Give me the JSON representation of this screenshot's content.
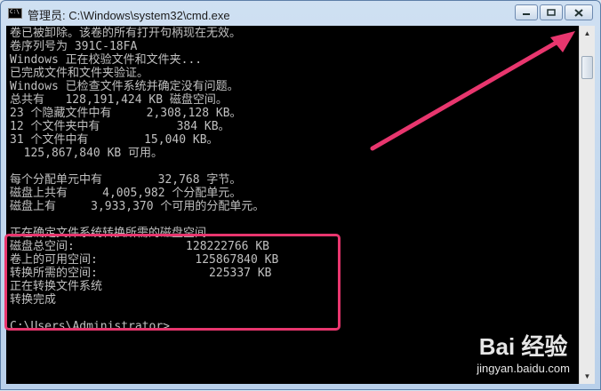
{
  "window": {
    "title": "管理员: C:\\Windows\\system32\\cmd.exe"
  },
  "controls": {
    "minimize_icon": "minimize-icon",
    "maximize_icon": "maximize-icon",
    "close_icon": "close-icon"
  },
  "console": {
    "lines": [
      "卷已被卸除。该卷的所有打开句柄现在无效。",
      "卷序列号为 391C-18FA",
      "Windows 正在校验文件和文件夹...",
      "已完成文件和文件夹验证。",
      "Windows 已检查文件系统并确定没有问题。",
      "总共有   128,191,424 KB 磁盘空间。",
      "23 个隐藏文件中有     2,308,128 KB。",
      "12 个文件夹中有           384 KB。",
      "31 个文件中有        15,040 KB。",
      "  125,867,840 KB 可用。",
      "",
      "每个分配单元中有        32,768 字节。",
      "磁盘上共有     4,005,982 个分配单元。",
      "磁盘上有     3,933,370 个可用的分配单元。",
      "",
      "正在确定文件系统转换所需的磁盘空间...",
      "磁盘总空间:                128222766 KB",
      "卷上的可用空间:              125867840 KB",
      "转换所需的空间:                225337 KB",
      "正在转换文件系统",
      "转换完成",
      "",
      "C:\\Users\\Administrator>"
    ]
  },
  "watermark": {
    "logo": "Bai 经验",
    "url": "jingyan.baidu.com"
  },
  "colors": {
    "annotation": "#e8366e",
    "console_text": "#c0c0c0",
    "console_bg": "#000000"
  }
}
